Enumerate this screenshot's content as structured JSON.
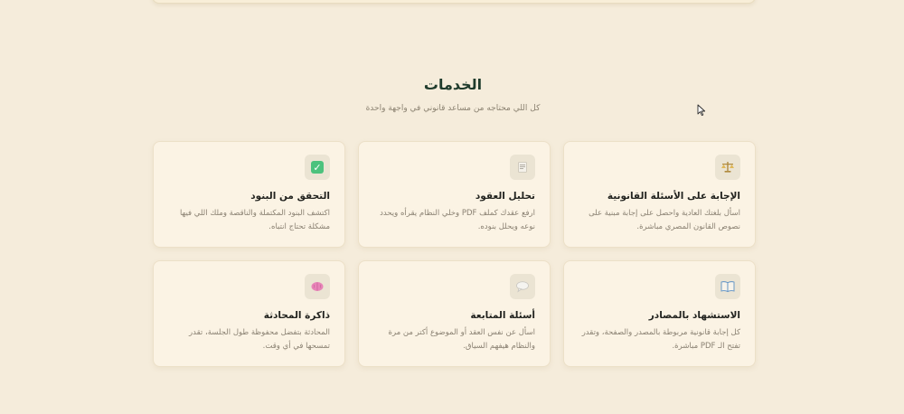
{
  "services": {
    "title": "الخدمات",
    "subtitle": "كل اللي محتاجه من مساعد قانوني في واجهة واحدة",
    "cards": [
      {
        "icon": "scales-icon",
        "title": "الإجابة على الأسئلة القانونية",
        "description": "اسأل بلغتك العادية واحصل على إجابة مبنية على نصوص القانون المصري مباشرة."
      },
      {
        "icon": "document-icon",
        "title": "تحليل العقود",
        "description": "ارفع عقدك كملف PDF وخلي النظام يقرأه ويحدد نوعه ويحلل بنوده."
      },
      {
        "icon": "checkmark-icon",
        "title": "التحقق من البنود",
        "description": "اكتشف البنود المكتملة والناقصة وملك اللي فيها مشكلة تحتاج انتباه."
      },
      {
        "icon": "book-icon",
        "title": "الاستشهاد بالمصادر",
        "description": "كل إجابة قانونية مربوطة بالمصدر والصفحة، وتقدر تفتح الـ PDF مباشرة."
      },
      {
        "icon": "speech-bubble-icon",
        "title": "أسئلة المتابعة",
        "description": "اسأل عن نفس العقد أو الموضوع أكتر من مرة والنظام هيفهم السياق."
      },
      {
        "icon": "brain-icon",
        "title": "ذاكرة المحادثة",
        "description": "المحادثة بتفضل محفوظة طول الجلسة، تقدر تمسحها في أي وقت."
      }
    ]
  },
  "colors": {
    "background": "#f5ecdb",
    "card": "#fbf3e4",
    "title": "#1f3b2c",
    "check_green": "#4cc27d",
    "brain_pink": "#e884b8"
  }
}
